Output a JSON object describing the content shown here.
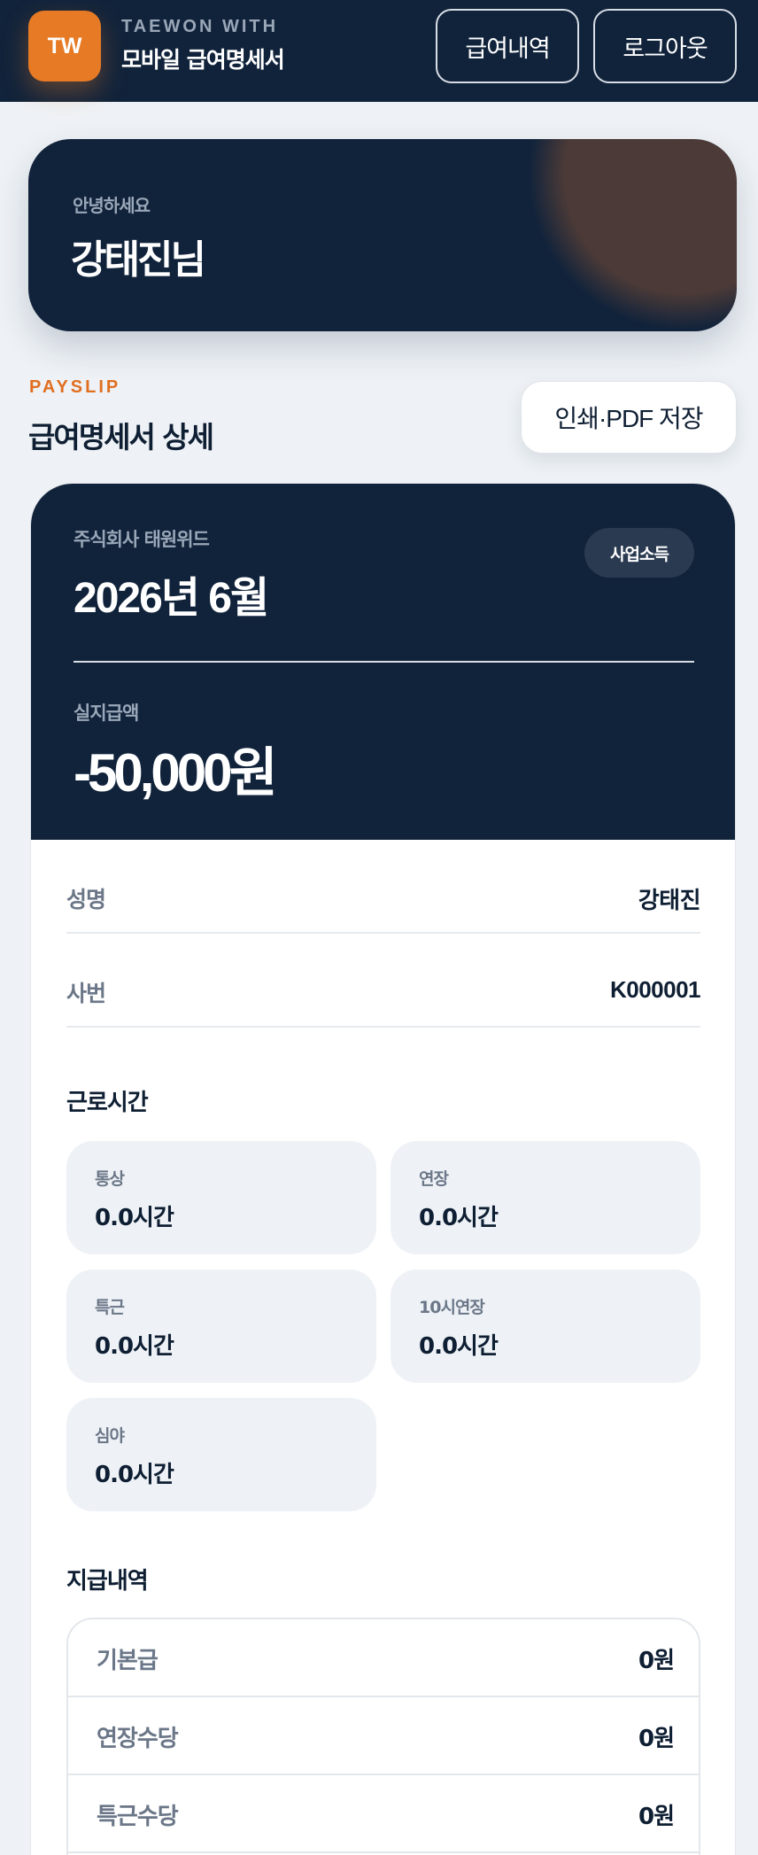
{
  "header": {
    "logo_text": "TW",
    "brand_top": "TAEWON WITH",
    "brand_title": "모바일 급여명세서",
    "history_button": "급여내역",
    "logout_button": "로그아웃"
  },
  "greeting": {
    "hello": "안녕하세요",
    "name": "강태진님"
  },
  "section": {
    "eyebrow": "PAYSLIP",
    "title": "급여명세서 상세",
    "print_button": "인쇄·PDF 저장"
  },
  "payslip": {
    "company": "주식회사 태원위드",
    "period": "2026년 6월",
    "badge": "사업소득",
    "net_label": "실지급액",
    "net_amount": "-50,000원",
    "info": [
      {
        "label": "성명",
        "value": "강태진"
      },
      {
        "label": "사번",
        "value": "K000001"
      }
    ],
    "work_hours_title": "근로시간",
    "work_hours": [
      {
        "label": "통상",
        "value": "0.0시간"
      },
      {
        "label": "연장",
        "value": "0.0시간"
      },
      {
        "label": "특근",
        "value": "0.0시간"
      },
      {
        "label": "10시연장",
        "value": "0.0시간"
      },
      {
        "label": "심야",
        "value": "0.0시간"
      }
    ],
    "payments_title": "지급내역",
    "payments": [
      {
        "label": "기본급",
        "value": "0원"
      },
      {
        "label": "연장수당",
        "value": "0원"
      },
      {
        "label": "특근수당",
        "value": "0원"
      }
    ]
  },
  "colors": {
    "navy": "#11233b",
    "accent_orange": "#e67a25",
    "background": "#eef2f6"
  }
}
